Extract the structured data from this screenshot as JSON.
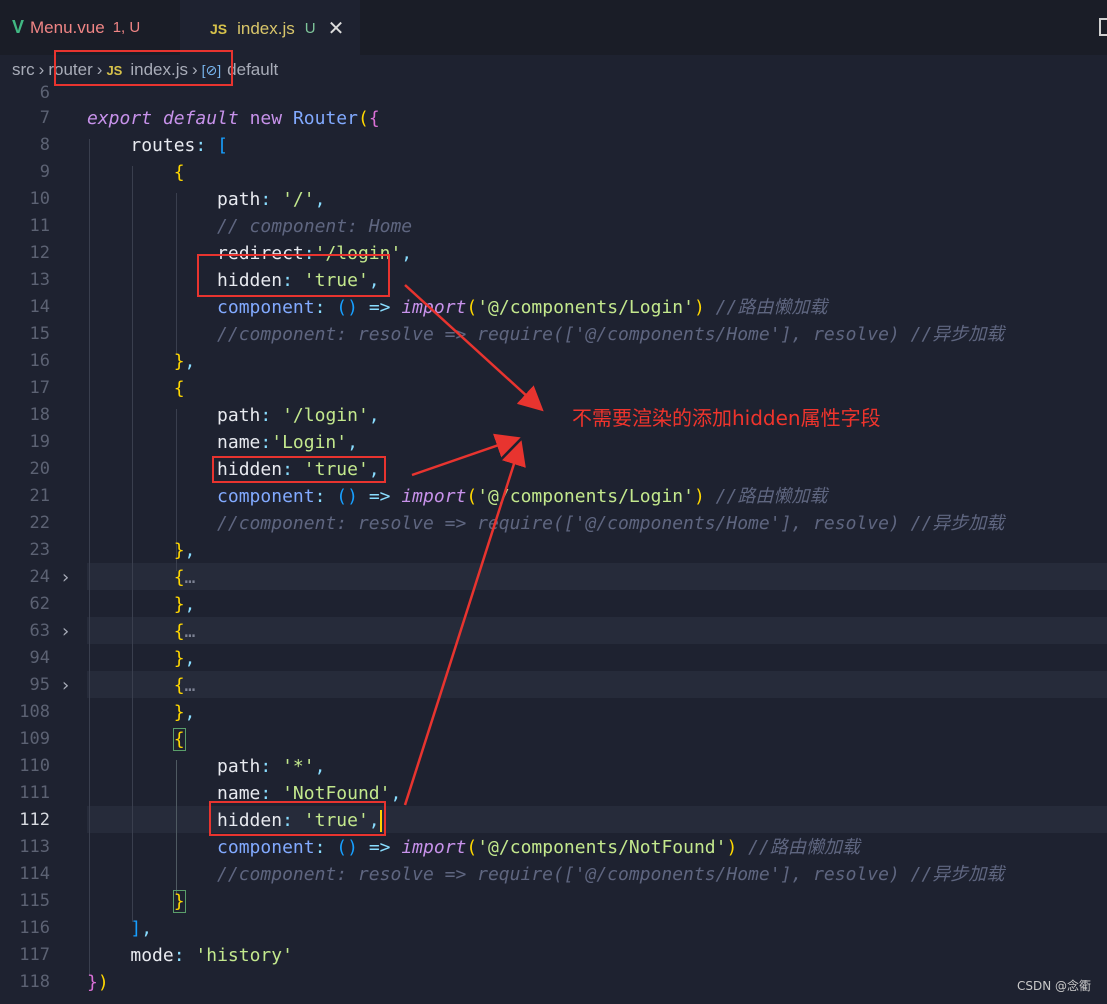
{
  "tabs": [
    {
      "icon": "vue-icon",
      "label": "Menu.vue",
      "status": "1, U"
    },
    {
      "icon": "js-icon",
      "icon_text": "JS",
      "label": "index.js",
      "status": "U",
      "close": "✕"
    }
  ],
  "breadcrumb": {
    "items": [
      "src",
      "router",
      "index.js",
      "default"
    ],
    "js_icon_text": "JS"
  },
  "editor": {
    "line_numbers": [
      "6",
      "7",
      "8",
      "9",
      "10",
      "11",
      "12",
      "13",
      "14",
      "15",
      "16",
      "17",
      "18",
      "19",
      "20",
      "21",
      "22",
      "23",
      "24",
      "62",
      "63",
      "94",
      "95",
      "108",
      "109",
      "110",
      "111",
      "112",
      "113",
      "114",
      "115",
      "116",
      "117",
      "118"
    ],
    "active_line": "112",
    "folded_lines": [
      "24",
      "63",
      "95"
    ],
    "ellipsis": "…",
    "text": {
      "export": "export",
      "default": "default",
      "new": "new",
      "router_cls": "Router",
      "routes": "routes",
      "path": "path",
      "name": "name",
      "redirect": "redirect",
      "hidden": "hidden",
      "component": "component",
      "mode": "mode",
      "import": "import",
      "root_path": "'/'",
      "login_path": "'/login'",
      "login_name": "'Login'",
      "star_path": "'*'",
      "notfound_name": "'NotFound'",
      "true_str": "'true'",
      "login_comp": "'@/components/Login'",
      "notfound_comp": "'@/components/NotFound'",
      "history": "'history'",
      "comment_home": "// component: Home",
      "comment_lazy": "//路由懒加载",
      "comment_async": "//component: resolve => require(['@/components/Home'], resolve) //异步加载"
    }
  },
  "annotation": "不需要渲染的添加hidden属性字段",
  "watermark": "CSDN @念衢",
  "colors": {
    "annotation_red": "#e8342f",
    "background": "#1e2230"
  }
}
